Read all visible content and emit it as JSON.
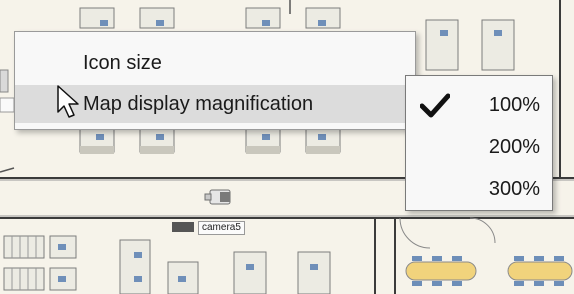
{
  "context_menu": {
    "items": [
      {
        "label": "Icon size"
      },
      {
        "label": "Map display magnification"
      }
    ]
  },
  "submenu": {
    "selected": "100%",
    "items": [
      {
        "label": "100%",
        "checked": true
      },
      {
        "label": "200%",
        "checked": false
      },
      {
        "label": "300%",
        "checked": false
      }
    ]
  },
  "map": {
    "camera_label": "camera5",
    "partial_label": "me"
  }
}
